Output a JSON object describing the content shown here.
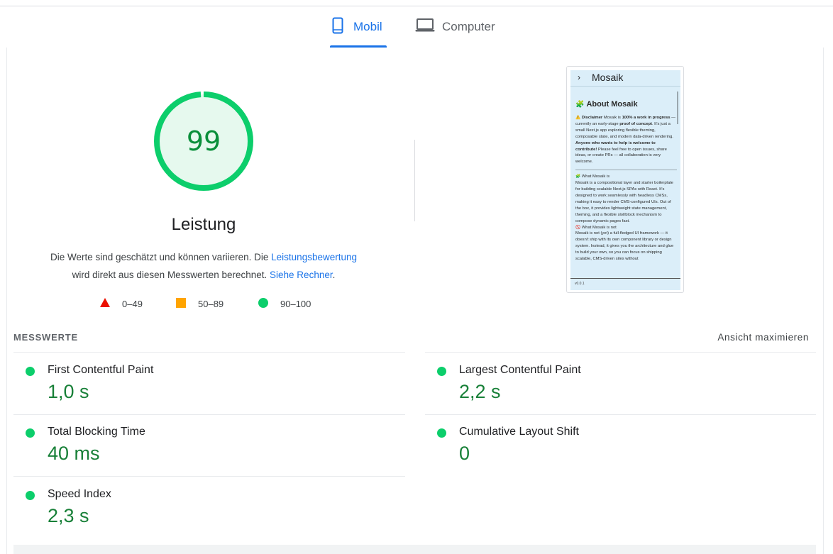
{
  "tabs": [
    {
      "label": "Mobil",
      "icon": "smartphone-icon",
      "active": true
    },
    {
      "label": "Computer",
      "icon": "laptop-icon",
      "active": false
    }
  ],
  "colors": {
    "accent": "#1a73e8",
    "pass": "#0cce6b",
    "pass_text": "#188038",
    "average": "#ffa400",
    "fail": "#ff4e42"
  },
  "gauge": {
    "score": "99",
    "score_fraction": 0.99,
    "title": "Leistung",
    "desc_part1": "Die Werte sind geschätzt und können variieren. Die ",
    "desc_link1": "Leistungsbewertung",
    "desc_part2": "wird direkt aus diesen Messwerten berechnet.",
    "desc_link2": "Siehe Rechner",
    "desc_end": "."
  },
  "legend": [
    {
      "range": "0–49",
      "shape": "triangle-icon"
    },
    {
      "range": "50–89",
      "shape": "square-icon"
    },
    {
      "range": "90–100",
      "shape": "circle-icon"
    }
  ],
  "screenshot": {
    "header_chevron": "›",
    "header_title": "Mosaik",
    "heading_emoji": "🧩",
    "heading": "About Mosaik",
    "p1_warn": "⚠️",
    "p1_b1": "Disclaimer",
    "p1_t1": " Mosaik is ",
    "p1_b2": "100% a work in progress",
    "p1_t2": " — currently an early-stage ",
    "p1_b3": "proof of concept",
    "p1_t3": ". It's just a small Next.js app exploring flexible theming, composable state, and modern data-driven rendering. ",
    "p1_b4": "Anyone who wants to help is welcome to contribute!",
    "p1_t4": " Please feel free to open issues, share ideas, or create PRs — all collaboration is very welcome.",
    "s2_title": "🧩 What Mosaik is",
    "s2_text": "Mosaik is a compositional layer and starter boilerplate for building scalable Next.js SPAs with React. It's designed to work seamlessly with headless CMSs, making it easy to render CMS-configured UIs. Out of the box, it provides lightweight state management, theming, and a flexible slot/block mechanism to compose dynamic pages fast.",
    "s3_title": "🚫 What Mosaik is not",
    "s3_text": "Mosaik is not (yet) a full-fledged UI framework — it doesn't ship with its own component library or design system. Instead, it gives you the architecture and glue to build your own, so you can focus on shipping scalable, CMS-driven sites without",
    "version": "v0.0.1"
  },
  "metrics": {
    "header": "MESSWERTE",
    "toggle": "Ansicht maximieren",
    "items": [
      {
        "label": "First Contentful Paint",
        "value": "1,0 s"
      },
      {
        "label": "Largest Contentful Paint",
        "value": "2,2 s"
      },
      {
        "label": "Total Blocking Time",
        "value": "40 ms"
      },
      {
        "label": "Cumulative Layout Shift",
        "value": "0"
      },
      {
        "label": "Speed Index",
        "value": "2,3 s"
      }
    ]
  }
}
